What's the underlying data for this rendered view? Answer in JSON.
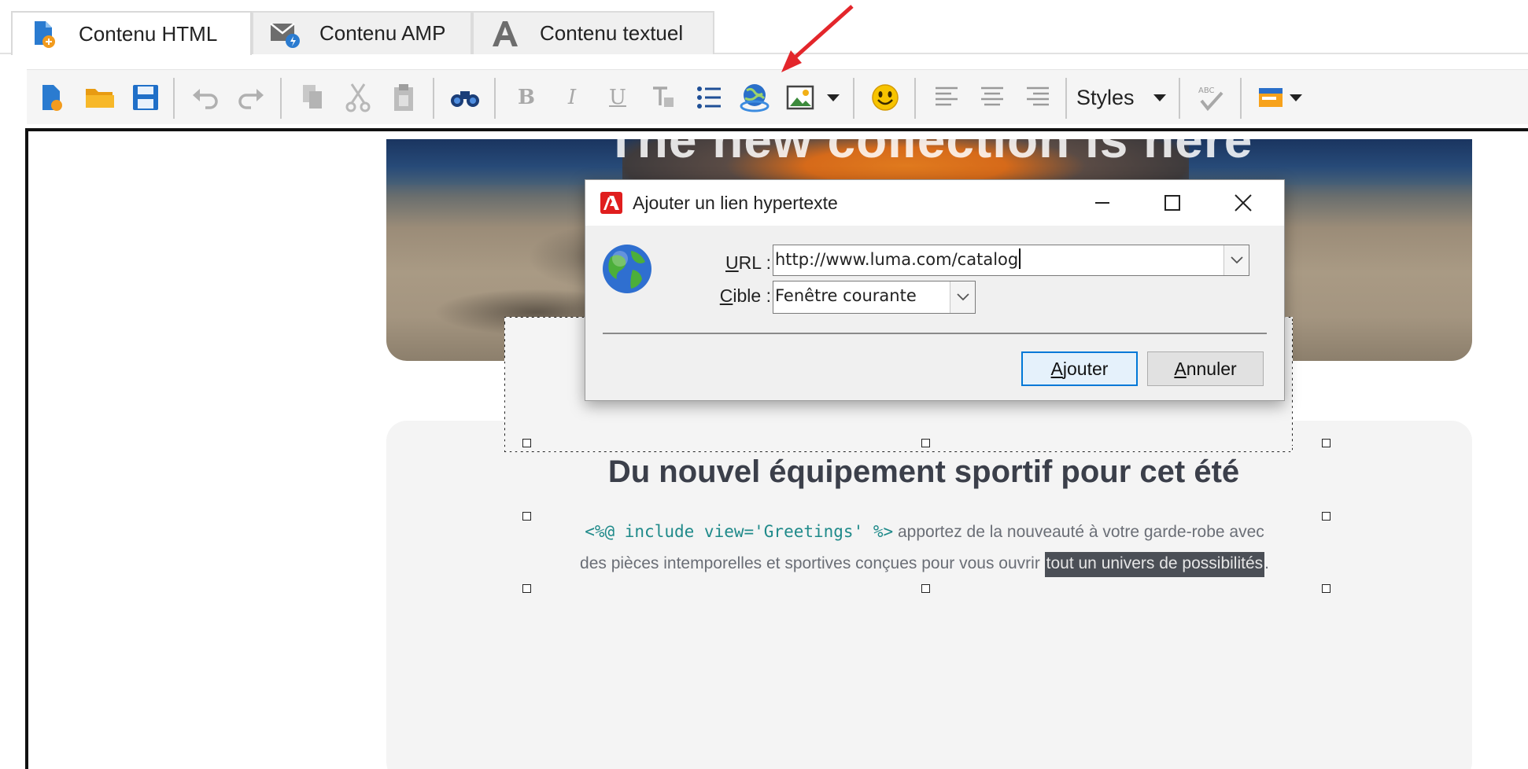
{
  "tabs": [
    {
      "label": "Contenu HTML",
      "active": true
    },
    {
      "label": "Contenu AMP",
      "active": false
    },
    {
      "label": "Contenu textuel",
      "active": false
    }
  ],
  "toolbar": {
    "styles_label": "Styles",
    "icons": [
      "new-document-icon",
      "open-folder-icon",
      "save-icon",
      "undo-icon",
      "redo-icon",
      "copy-icon",
      "cut-icon",
      "paste-icon",
      "find-icon",
      "bold-icon",
      "italic-icon",
      "underline-icon",
      "clear-format-icon",
      "bullet-list-icon",
      "hyperlink-icon",
      "image-icon",
      "smiley-icon",
      "align-left-icon",
      "align-center-icon",
      "align-right-icon",
      "spellcheck-icon",
      "personalization-icon"
    ]
  },
  "content": {
    "hero_title": "The new collection is here",
    "title": "Du nouvel équipement sportif pour cet été",
    "code_tag": "<%@ include view='Greetings' %>",
    "line1_text": " apportez de la nouveauté à votre garde-robe avec",
    "line2_text": "des pièces intemporelles et sportives conçues pour vous ouvrir ",
    "highlighted_text": "tout un univers de possibilités",
    "line2_end": "."
  },
  "dialog": {
    "title": "Ajouter un lien hypertexte",
    "url_label_accel": "U",
    "url_label_rest": "RL :",
    "url_value": "http://www.luma.com/catalog",
    "target_label_accel": "C",
    "target_label_rest": "ible :",
    "target_value": "Fenêtre courante",
    "add_button_accel": "A",
    "add_button_rest": "jouter",
    "cancel_button_accel": "A",
    "cancel_button_rest": "nnuler"
  },
  "colors": {
    "accent_red": "#e3262b",
    "primary_button_border": "#0078d7",
    "title_text": "#3b3f4a",
    "code_tag": "#1f8a8a",
    "highlight_bg": "#4b4f56"
  }
}
